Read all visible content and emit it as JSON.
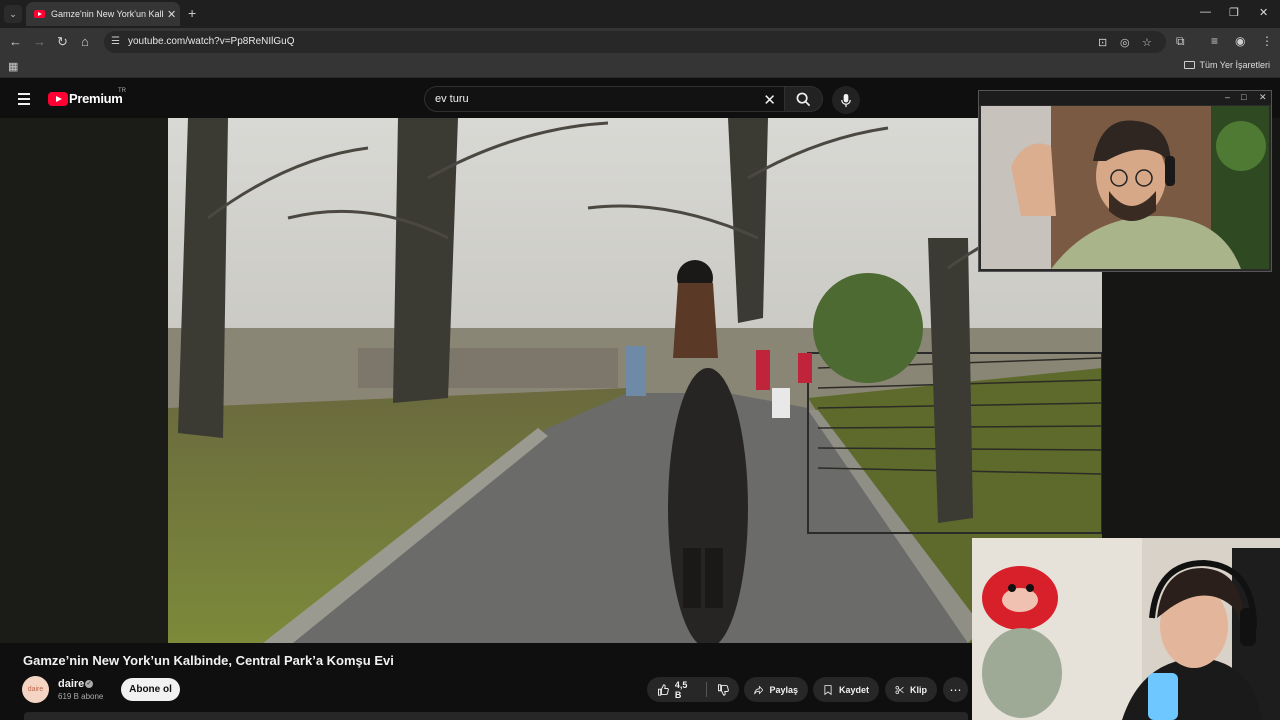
{
  "browser": {
    "tab": {
      "title": "Gamze'nin New York'un Kalbinde, Central Park'a Komşu Evi",
      "favicon": "youtube-icon"
    },
    "url": "youtube.com/watch?v=Pp8ReNIlGuQ",
    "bookmarks_folder": "Tüm Yer İşaretleri"
  },
  "youtube": {
    "logo_text": "Premium",
    "country_code": "TR",
    "search": {
      "value": "ev turu"
    },
    "video": {
      "title": "Gamze’nin New York’un Kalbinde, Central Park’a Komşu Evi",
      "channel": "daire",
      "avatar_text": "daire",
      "subscribers": "619 B abone",
      "subscribe_label": "Abone ol",
      "likes": "4,5 B",
      "share_label": "Paylaş",
      "save_label": "Kaydet",
      "clip_label": "Klip"
    }
  },
  "colors": {
    "youtube_red": "#ff0033",
    "background": "#0f0f0f",
    "pill": "#272727"
  }
}
